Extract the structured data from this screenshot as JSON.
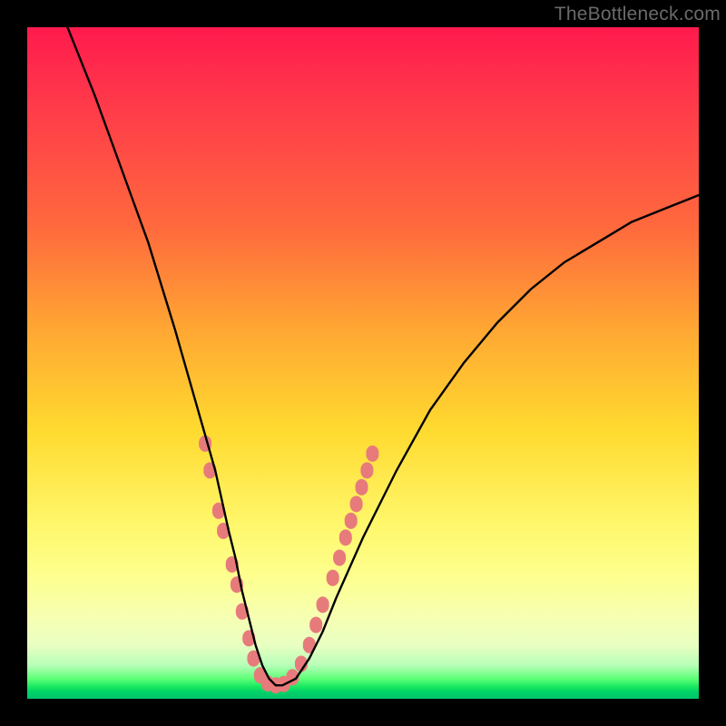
{
  "watermark": "TheBottleneck.com",
  "chart_data": {
    "type": "line",
    "title": "",
    "xlabel": "",
    "ylabel": "",
    "xlim": [
      0,
      100
    ],
    "ylim": [
      0,
      100
    ],
    "grid": false,
    "legend": false,
    "series": [
      {
        "name": "bottleneck-curve",
        "color": "#000000",
        "x": [
          6,
          10,
          14,
          18,
          22,
          24,
          26,
          28,
          30,
          31,
          32,
          33,
          34,
          35,
          36,
          37,
          38,
          40,
          42,
          44,
          46,
          50,
          55,
          60,
          65,
          70,
          75,
          80,
          85,
          90,
          95,
          100
        ],
        "y": [
          100,
          90,
          79,
          68,
          55,
          48,
          41,
          34,
          25,
          21,
          16,
          12,
          8,
          5,
          3,
          2,
          2,
          3,
          6,
          10,
          15,
          24,
          34,
          43,
          50,
          56,
          61,
          65,
          68,
          71,
          73,
          75
        ]
      }
    ],
    "markers": [
      {
        "name": "scatter-dots",
        "color": "#e77b7b",
        "shape": "rounded-rect",
        "points": [
          {
            "x": 26.5,
            "y": 38
          },
          {
            "x": 27.2,
            "y": 34
          },
          {
            "x": 28.5,
            "y": 28
          },
          {
            "x": 29.2,
            "y": 25
          },
          {
            "x": 30.5,
            "y": 20
          },
          {
            "x": 31.2,
            "y": 17
          },
          {
            "x": 32.0,
            "y": 13
          },
          {
            "x": 33.0,
            "y": 9
          },
          {
            "x": 33.7,
            "y": 6
          },
          {
            "x": 34.7,
            "y": 3.5
          },
          {
            "x": 35.8,
            "y": 2.3
          },
          {
            "x": 37.0,
            "y": 2.0
          },
          {
            "x": 38.2,
            "y": 2.2
          },
          {
            "x": 39.5,
            "y": 3.2
          },
          {
            "x": 40.8,
            "y": 5.2
          },
          {
            "x": 42.0,
            "y": 8
          },
          {
            "x": 43.0,
            "y": 11
          },
          {
            "x": 44.0,
            "y": 14
          },
          {
            "x": 45.5,
            "y": 18
          },
          {
            "x": 46.5,
            "y": 21
          },
          {
            "x": 47.4,
            "y": 24
          },
          {
            "x": 48.2,
            "y": 26.5
          },
          {
            "x": 49.0,
            "y": 29
          },
          {
            "x": 49.8,
            "y": 31.5
          },
          {
            "x": 50.6,
            "y": 34
          },
          {
            "x": 51.4,
            "y": 36.5
          }
        ]
      }
    ]
  }
}
